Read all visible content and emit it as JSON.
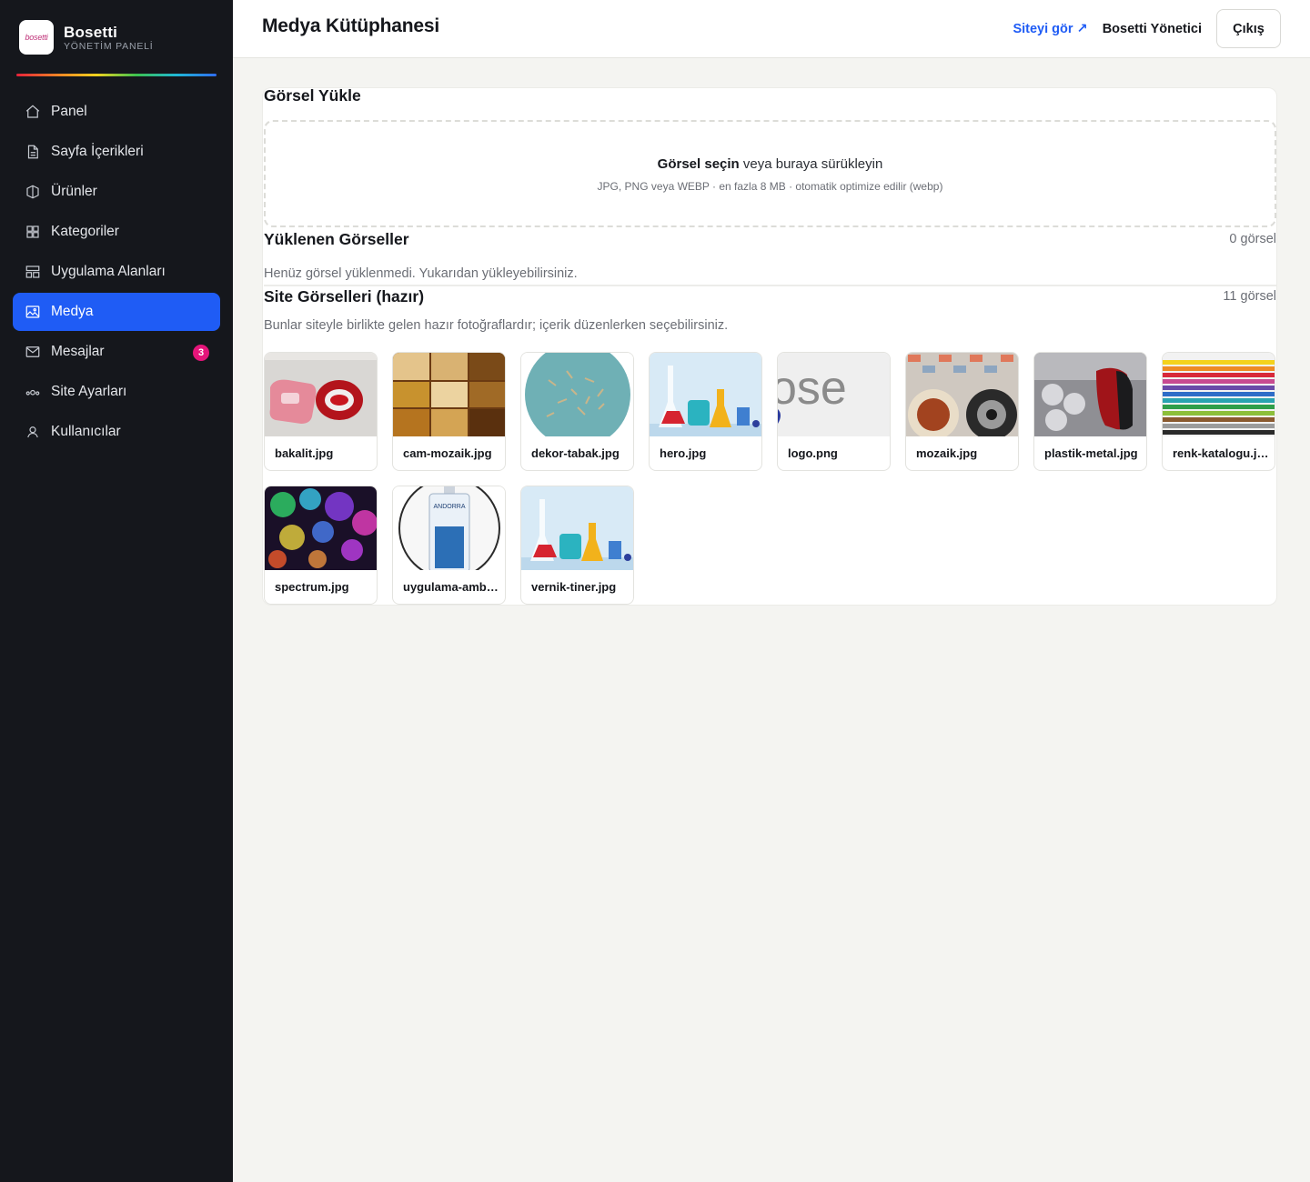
{
  "brand": {
    "name": "Bosetti",
    "subtitle": "YÖNETİM PANELİ",
    "logo_text": "bosetti"
  },
  "sidebar": {
    "items": [
      {
        "label": "Panel",
        "icon": "home-icon",
        "active": false
      },
      {
        "label": "Sayfa İçerikleri",
        "icon": "document-icon",
        "active": false
      },
      {
        "label": "Ürünler",
        "icon": "box-icon",
        "active": false
      },
      {
        "label": "Kategoriler",
        "icon": "grid-icon",
        "active": false
      },
      {
        "label": "Uygulama Alanları",
        "icon": "layout-icon",
        "active": false
      },
      {
        "label": "Medya",
        "icon": "image-icon",
        "active": true
      },
      {
        "label": "Mesajlar",
        "icon": "mail-icon",
        "active": false,
        "badge": "3"
      },
      {
        "label": "Site Ayarları",
        "icon": "settings-icon",
        "active": false
      },
      {
        "label": "Kullanıcılar",
        "icon": "user-icon",
        "active": false
      }
    ]
  },
  "header": {
    "title": "Medya Kütüphanesi",
    "site_link": "Siteyi gör ↗",
    "user": "Bosetti Yönetici",
    "logout": "Çıkış"
  },
  "upload": {
    "title": "Görsel Yükle",
    "select_label": "Görsel seçin",
    "drag_label": "veya buraya sürükleyin",
    "hint": "JPG, PNG veya WEBP · en fazla 8 MB · otomatik optimize edilir (webp)"
  },
  "uploaded": {
    "title": "Yüklenen Görseller",
    "count": "0 görsel",
    "empty": "Henüz görsel yüklenmedi. Yukarıdan yükleyebilirsiniz."
  },
  "site_images": {
    "title": "Site Görselleri (hazır)",
    "count": "11 görsel",
    "description": "Bunlar siteyle birlikte gelen hazır fotoğraflardır; içerik düzenlerken seçebilirsiniz.",
    "files": [
      "bakalit.jpg",
      "cam-mozaik.jpg",
      "dekor-tabak.jpg",
      "hero.jpg",
      "logo.png",
      "mozaik.jpg",
      "plastik-metal.jpg",
      "renk-katalogu.jpg",
      "spectrum.jpg",
      "uygulama-ambalaj.jpg",
      "vernik-tiner.jpg"
    ]
  },
  "colors": {
    "accent": "#1f5cf5",
    "sidebar_bg": "#15171c",
    "badge": "#e5157a"
  }
}
